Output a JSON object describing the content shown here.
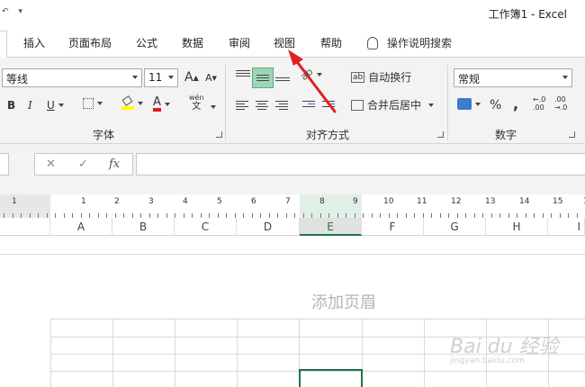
{
  "window": {
    "title": "工作簿1  -  Excel",
    "qat_undo": "↶",
    "qat_menu": "▾"
  },
  "tabs": [
    "插入",
    "页面布局",
    "公式",
    "数据",
    "审阅",
    "视图",
    "帮助"
  ],
  "tell_me": "操作说明搜索",
  "ribbon": {
    "font_name": "等线",
    "font_size": "11",
    "grow_font": "A",
    "shrink_font": "A",
    "bold": "B",
    "italic": "I",
    "underline": "U",
    "font_color": "A",
    "phonetic": "wén",
    "phonetic_sub": "文",
    "font_group_label": "字体",
    "orientation_label": "ab",
    "wrap_text": "自动换行",
    "merge_center": "合并后居中",
    "alignment_group_label": "对齐方式",
    "number_format": "常规",
    "percent": "%",
    "comma": ",",
    "inc_decimal": "←.0\n.00",
    "dec_decimal": ".00\n→.0",
    "number_group_label": "数字"
  },
  "formula_bar": {
    "cancel": "✕",
    "enter": "✓",
    "fx": "fx",
    "value": ""
  },
  "ruler": {
    "numbers": [
      "1",
      "1",
      "2",
      "3",
      "4",
      "5",
      "6",
      "7",
      "8",
      "9",
      "10",
      "11",
      "12",
      "13",
      "14",
      "15",
      "16"
    ]
  },
  "columns": [
    "A",
    "B",
    "C",
    "D",
    "E",
    "F",
    "G",
    "H",
    "I"
  ],
  "selected_column": "E",
  "page": {
    "header_placeholder": "添加页眉"
  },
  "watermark": {
    "brand": "Bai du 经验",
    "url": "jingyan.baidu.com"
  },
  "colors": {
    "accent": "#217346",
    "selected_align": "#9fd5b7",
    "arrow": "#e02020"
  }
}
